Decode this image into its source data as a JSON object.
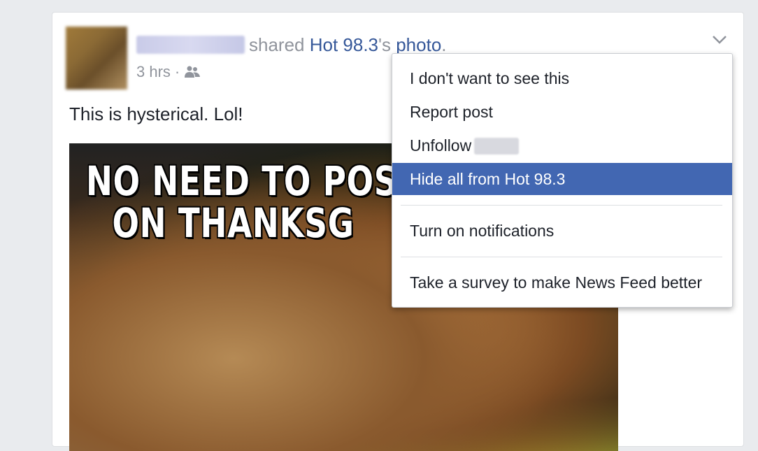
{
  "post": {
    "shared_text": "shared",
    "page_name": "Hot 98.3",
    "photo_suffix_pre": "'s ",
    "photo_link": "photo",
    "period": ".",
    "time": "3 hrs",
    "separator": "·",
    "audience_icon": "friends-icon",
    "text": "This is hysterical. Lol!",
    "image_caption_line1": "NO NEED TO POST Y",
    "image_caption_line2": "ON THANKSG"
  },
  "menu": {
    "items": [
      {
        "label": "I don't want to see this"
      },
      {
        "label": "Report post"
      },
      {
        "label": "Unfollow"
      },
      {
        "label": "Hide all from Hot 98.3"
      },
      {
        "label": "Turn on notifications"
      },
      {
        "label": "Take a survey to make News Feed better"
      }
    ]
  },
  "colors": {
    "link": "#365899",
    "highlight": "#4267b2",
    "meta_text": "#90949c"
  }
}
